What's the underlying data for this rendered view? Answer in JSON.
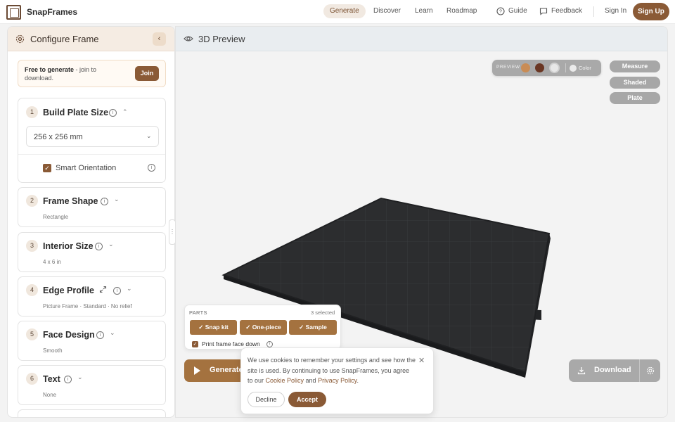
{
  "app": {
    "brand": "SnapFrames"
  },
  "nav": {
    "generate": "Generate",
    "discover": "Discover",
    "learn": "Learn",
    "roadmap": "Roadmap",
    "guide": "Guide",
    "feedback": "Feedback",
    "sign_in": "Sign In",
    "sign_up": "Sign Up"
  },
  "sidebar": {
    "title": "Configure Frame",
    "promo": {
      "bold": "Free to generate",
      "rest": " - join to download.",
      "join": "Join"
    },
    "cards": [
      {
        "num": "1",
        "title": "Build Plate Size",
        "select_value": "256 x 256 mm",
        "checkbox_label": "Smart Orientation",
        "checked": true
      },
      {
        "num": "2",
        "title": "Frame Shape",
        "sub": "Rectangle"
      },
      {
        "num": "3",
        "title": "Interior Size",
        "sub": "4 x 6 in"
      },
      {
        "num": "4",
        "title": "Edge Profile",
        "sub": "Picture Frame · Standard · No relief"
      },
      {
        "num": "5",
        "title": "Face Design",
        "sub": "Smooth"
      },
      {
        "num": "6",
        "title": "Text",
        "sub": "None"
      }
    ]
  },
  "preview": {
    "title": "3D Preview",
    "palette": {
      "label": "PREVIEW",
      "color_label": "Color",
      "swatches": [
        "#c98c55",
        "#6a3623",
        "#e7e7e7",
        "#eaeaea"
      ]
    },
    "modes": [
      "Measure",
      "Shaded",
      "Plate"
    ],
    "parts": {
      "label": "PARTS",
      "count": "3 selected",
      "buttons": [
        "Snap kit",
        "One-piece",
        "Sample"
      ],
      "face_down_label": "Print frame face down"
    },
    "generate_label": "Generate",
    "download_label": "Download"
  },
  "cookie": {
    "text": "We use cookies to remember your settings and see how the site is used. By continuing to use SnapFrames, you agree to our ",
    "cookie_policy": "Cookie Policy",
    "and": " and ",
    "privacy_policy": "Privacy Policy",
    "end": ".",
    "decline": "Decline",
    "accept": "Accept"
  },
  "colors": {
    "accent": "#8a5a36",
    "accent_light": "#a4723f",
    "plate": "#2c2d2f"
  }
}
